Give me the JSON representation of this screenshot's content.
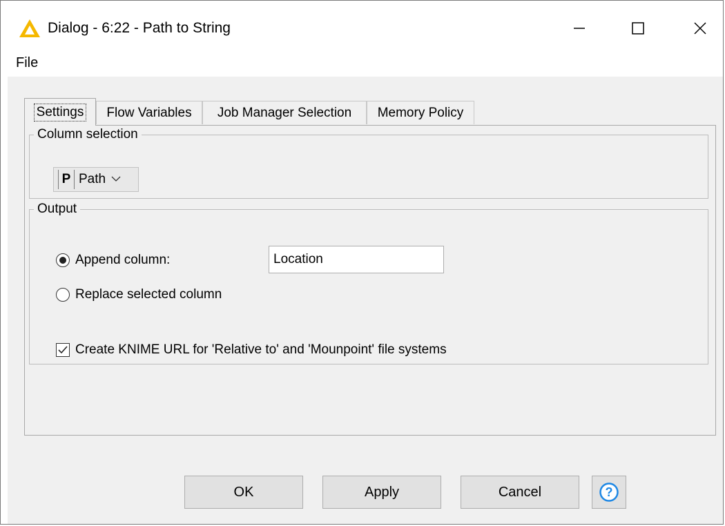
{
  "window": {
    "title": "Dialog - 6:22 - Path to String",
    "app_icon": "knime-triangle-icon",
    "controls": [
      "minimize-icon",
      "maximize-icon",
      "close-icon"
    ]
  },
  "menu": {
    "file": "File"
  },
  "tabs": [
    {
      "label": "Settings",
      "active": true
    },
    {
      "label": "Flow Variables",
      "active": false
    },
    {
      "label": "Job Manager Selection",
      "active": false
    },
    {
      "label": "Memory Policy",
      "active": false
    }
  ],
  "column_selection": {
    "legend": "Column selection",
    "type_badge": "P",
    "selected_column": "Path"
  },
  "output": {
    "legend": "Output",
    "append_label": "Append column:",
    "append_selected": true,
    "append_value": "Location",
    "replace_label": "Replace selected column",
    "replace_selected": false,
    "knime_url_label": "Create KNIME URL for 'Relative to' and 'Mounpoint' file systems",
    "knime_url_checked": true
  },
  "buttons": {
    "ok": "OK",
    "apply": "Apply",
    "cancel": "Cancel",
    "help_icon": "help-icon"
  },
  "colors": {
    "knime_icon": "#f5b800",
    "help_icon": "#1e88e5"
  }
}
